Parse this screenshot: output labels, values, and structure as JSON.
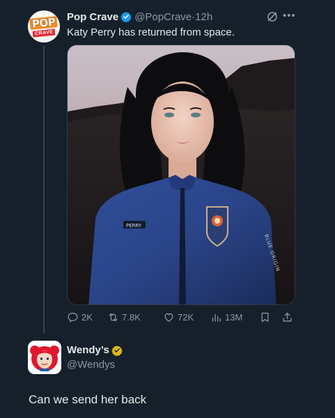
{
  "tweet": {
    "display_name": "Pop Crave",
    "handle": "@PopCrave",
    "separator": "·",
    "time": "12h",
    "text": "Katy Perry has returned from space.",
    "avatar_text_top": "POP",
    "avatar_text_bottom": "CRAVE",
    "media_badge": "PERRY",
    "sleeve_text": "BLUE ORIGIN",
    "actions": {
      "replies": "2K",
      "reposts": "7.8K",
      "likes": "72K",
      "views": "13M"
    }
  },
  "reply": {
    "display_name": "Wendy’s",
    "handle": "@Wendys",
    "text": "Can we send her back"
  },
  "colors": {
    "background": "#15202b",
    "verified_blue": "#1d9bf0",
    "verified_gold": "#e2b719",
    "muted": "#8b98a5"
  }
}
